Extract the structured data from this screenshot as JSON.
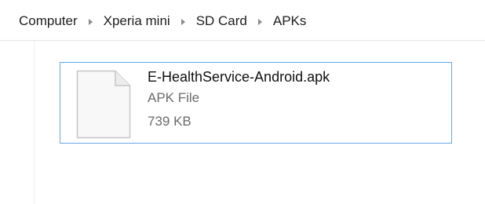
{
  "breadcrumb": {
    "items": [
      {
        "label": "Computer"
      },
      {
        "label": "Xperia mini"
      },
      {
        "label": "SD Card"
      },
      {
        "label": "APKs"
      }
    ]
  },
  "file": {
    "name": "E-HealthService-Android.apk",
    "type": "APK File",
    "size": "739 KB",
    "icon": "generic-document-icon"
  },
  "colors": {
    "selection_border": "#66a7e8",
    "secondary_text": "#6b6b6b",
    "separator_arrow": "#8a8a8a"
  }
}
